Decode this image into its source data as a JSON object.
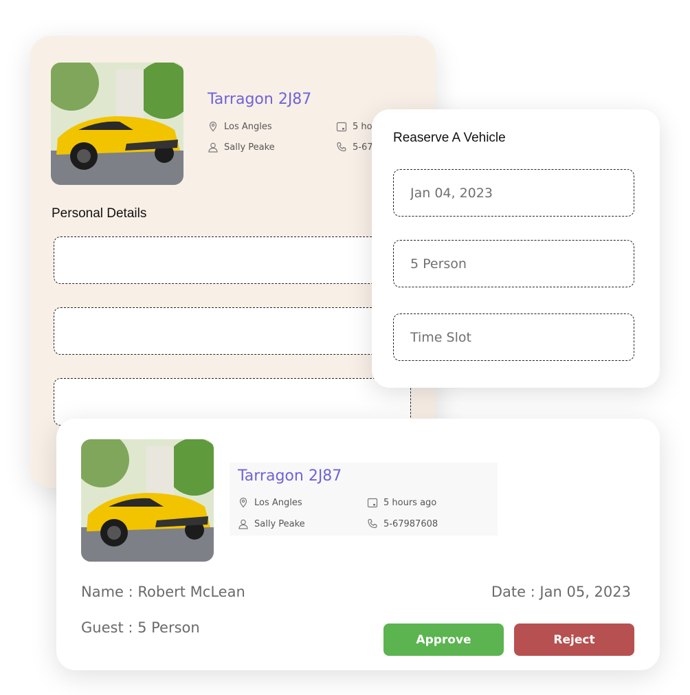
{
  "back_card": {
    "vehicle_title": "Tarragon 2J87",
    "location": "Los Angles",
    "owner": "Sally Peake",
    "time": "5 hours ago",
    "phone": "5-67987608",
    "section_title": "Personal Details",
    "fields": [
      "",
      "",
      ""
    ]
  },
  "reserve_card": {
    "title": "Reaserve A Vehicle",
    "date_value": "Jan 04, 2023",
    "guests_value": "5 Person",
    "time_slot_placeholder": "Time Slot"
  },
  "booking_card": {
    "vehicle_title": "Tarragon 2J87",
    "location": "Los Angles",
    "owner": "Sally Peake",
    "time": "5 hours ago",
    "phone": "5-67987608",
    "name_line": "Name : Robert McLean",
    "date_line": "Date : Jan 05, 2023",
    "guest_line": "Guest : 5 Person",
    "approve_label": "Approve",
    "reject_label": "Reject"
  },
  "colors": {
    "accent_title": "#6f63d8",
    "back_card_bg": "#f8efe7",
    "approve": "#5bb450",
    "reject": "#b75050"
  },
  "icons": [
    "location-pin-icon",
    "user-icon",
    "calendar-icon",
    "phone-icon",
    "car-photo"
  ]
}
